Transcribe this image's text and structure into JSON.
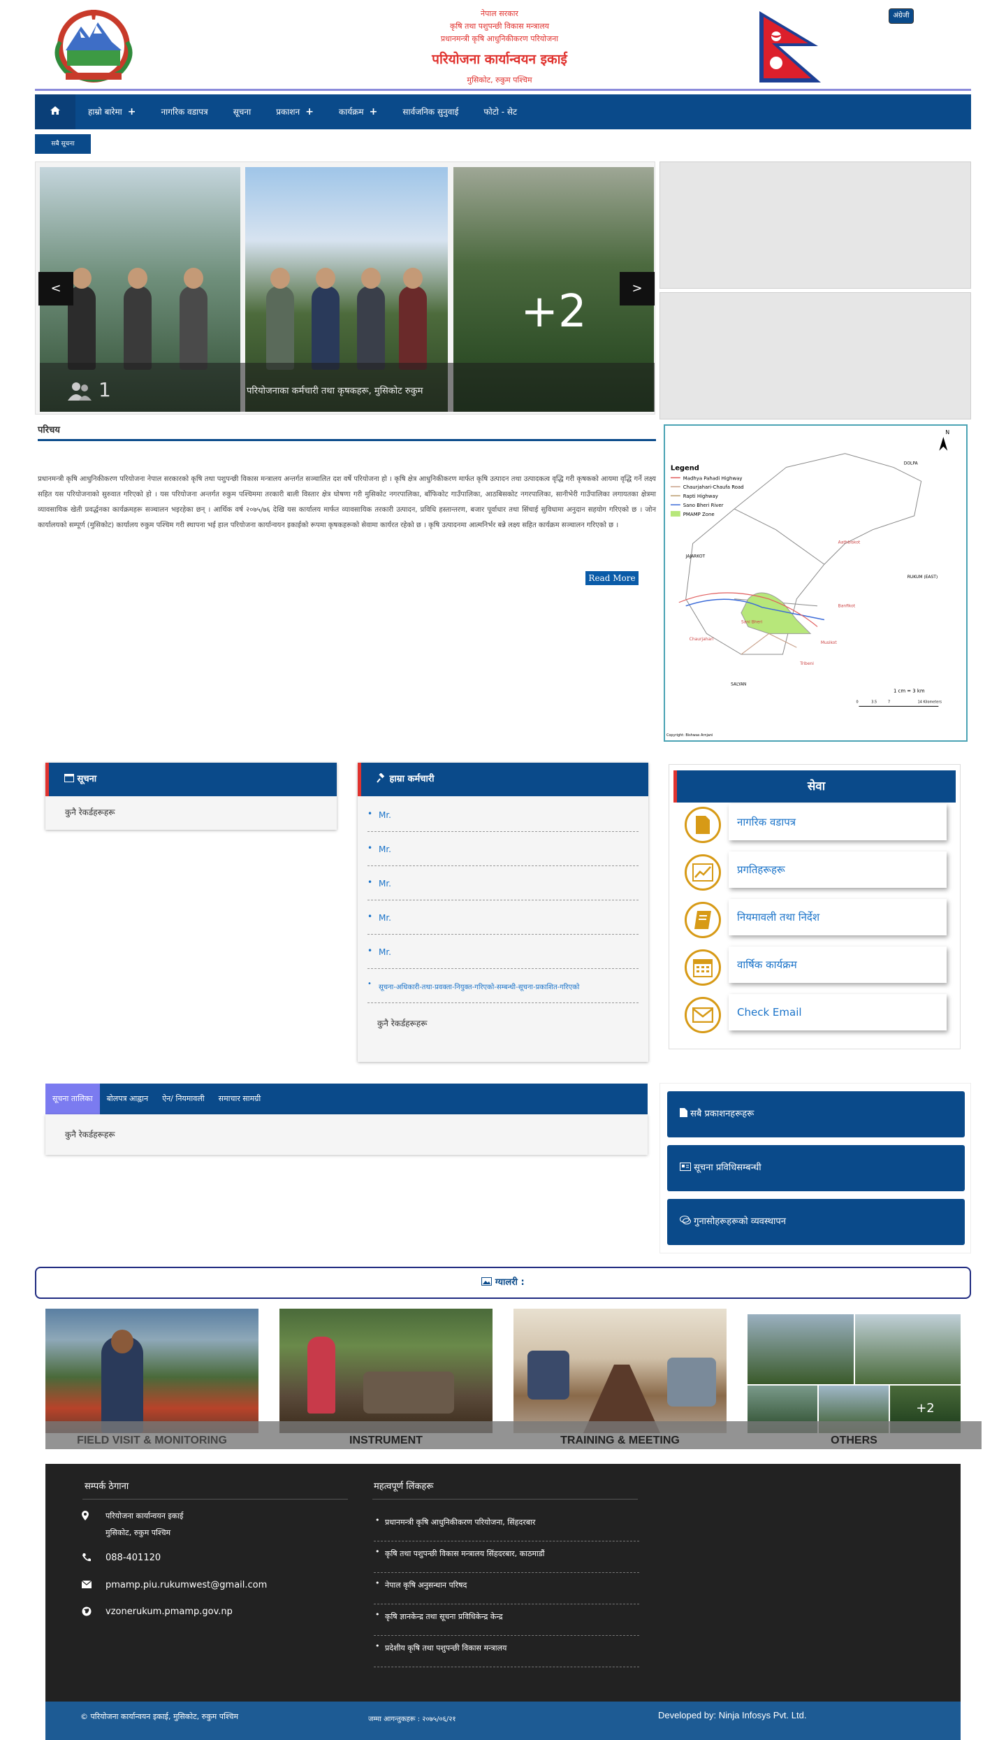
{
  "header": {
    "line1": "नेपाल सरकार",
    "line2": "कृषि तथा पशुपन्छी विकास मन्त्रालय",
    "line3": "प्रधानमन्त्री कृषि आधुनिकीकरण परियोजना",
    "title": "परियोजना कार्यान्वयन इकाई",
    "address": "मुसिकोट, रुकुम पश्चिम",
    "lang_button": "अंग्रेजी"
  },
  "nav": {
    "items": [
      {
        "label": "हाम्रो बारेमा",
        "plus": "+"
      },
      {
        "label": "नागरिक वडापत्र",
        "plus": ""
      },
      {
        "label": "सूचना",
        "plus": ""
      },
      {
        "label": "प्रकाशन",
        "plus": "+"
      },
      {
        "label": "कार्यक्रम",
        "plus": "+"
      },
      {
        "label": "सार्वजनिक सुनुवाई",
        "plus": ""
      },
      {
        "label": "फोटो - सेट",
        "plus": ""
      }
    ]
  },
  "notice_button": "सबै सूचना",
  "slider": {
    "count": "1",
    "caption": "परियोजनाका कर्मचारी तथा कृषकहरू, मुसिकोट रुकुम",
    "more": "+2",
    "prev": "<",
    "next": ">"
  },
  "about": {
    "title": "परिचय",
    "text": "प्रधानमन्त्री कृषि आधुनिकीकरण परियोजना नेपाल सरकारको कृषि तथा पशुपन्छी विकास मन्त्रालय अन्तर्गत सञ्चालित दश वर्षे परियोजना हो । कृषि क्षेत्र आधुनिकीकरण मार्फत कृषि उत्पादन तथा उत्पादकत्व वृद्धि गरी कृषकको आयमा वृद्धि गर्ने लक्ष्य सहित यस परियोजनाको सुरुवात गरिएको हो । यस परियोजना अन्तर्गत रुकुम पश्चिममा तरकारी बाली विस्तार क्षेत्र घोषणा गरी मुसिकोट नगरपालिका, बाँफिकोट गाउँपालिका, आठबिसकोट नगरपालिका, सानीभेरी गाउँपालिका लगायतका क्षेत्रमा व्यावसायिक खेती प्रवर्द्धनका कार्यक्रमहरू सञ्चालन भइरहेका छन् । आर्थिक वर्ष २०७५/७६ देखि यस कार्यालय मार्फत व्यावसायिक तरकारी उत्पादन, प्रविधि हस्तान्तरण, बजार पूर्वाधार तथा सिंचाई सुविधामा अनुदान सहयोग गरिएको छ । जोन कार्यालयको सम्पूर्ण (मुसिकोट) कार्यालय रुकुम पश्चिम गरी स्थापना भई हाल परियोजना कार्यान्वयन इकाईको रूपमा कृषकहरूको सेवामा कार्यरत रहेको छ । कृषि उत्पादनमा आत्मनिर्भर बन्ने लक्ष्य सहित कार्यक्रम सञ्चालन गरिएको छ ।",
    "read_more": "Read More"
  },
  "map": {
    "legend_title": "Legend",
    "legend": [
      {
        "label": "Madhya Pahadi Highway",
        "color": "#e05d5d"
      },
      {
        "label": "Chaurjahari-Chaufa Road",
        "color": "#c9a18a"
      },
      {
        "label": "Rapti Highway",
        "color": "#b99a6b"
      },
      {
        "label": "Sano Bheri River",
        "color": "#3a6ad8"
      },
      {
        "label": "PMAMP Zone",
        "color": "#b7e77a"
      }
    ],
    "labels": [
      "DOLPA",
      "JAJARKOT",
      "RUKUM (EAST)",
      "SALYAN",
      "Aathbiskot",
      "Banfikot",
      "Musikot",
      "Sani Bheri",
      "Tribeni",
      "Chaurjahari"
    ],
    "scale_text": "1 cm = 3 km",
    "scale_ticks": [
      "0",
      "3.5",
      "7",
      "14 Kilometers"
    ],
    "credit": "Copyright: Bishwas Arnjani",
    "north": "N"
  },
  "notices_panel": {
    "title": "सूचना",
    "empty": "कुनै रेकर्डहरूहरू"
  },
  "staff_panel": {
    "title": "हाम्रा कर्मचारी",
    "items": [
      "Mr.",
      "Mr.",
      "Mr.",
      "Mr.",
      "Mr.",
      "सूचना-अधिकारी-तथा-प्रवक्ता-नियुक्त-गरिएको-सम्बन्धी-सूचना-प्रकाशित-गरिएको"
    ],
    "empty": "कुनै रेकर्डहरूहरू"
  },
  "services": {
    "title": "सेवा",
    "items": [
      {
        "label": "नागरिक वडापत्र",
        "icon": "document-icon"
      },
      {
        "label": "प्रगतिहरूहरू",
        "icon": "chart-icon"
      },
      {
        "label": "नियमावली तथा निर्देश",
        "icon": "book-icon"
      },
      {
        "label": "वार्षिक कार्यक्रम",
        "icon": "calendar-icon"
      },
      {
        "label": "Check Email",
        "icon": "envelope-icon"
      }
    ]
  },
  "tabs": {
    "items": [
      "सूचना तालिका",
      "बोलपत्र आह्वान",
      "ऐन/ नियमावली",
      "समाचार सामग्री"
    ],
    "active": 0,
    "empty": "कुनै रेकर्डहरूहरू"
  },
  "right_buttons": [
    {
      "label": "सबै प्रकाशनहरूहरू",
      "icon": "file-icon"
    },
    {
      "label": "सूचना प्रविधिसम्बन्धी",
      "icon": "newspaper-icon"
    },
    {
      "label": "गुनासोहरूहरूको व्यवस्थापन",
      "icon": "comments-icon"
    }
  ],
  "gallery": {
    "title": "ग्यालरी :",
    "items": [
      {
        "label": "FIELD VISIT & MONITORING"
      },
      {
        "label": "INSTRUMENT"
      },
      {
        "label": "TRAINING & MEETING"
      },
      {
        "label": "OTHERS",
        "more": "+2"
      }
    ]
  },
  "footer": {
    "contact_title": "सम्पर्क ठेगाना",
    "office": "परियोजना कार्यान्वयन इकाई",
    "address": "मुसिकोट, रुकुम पश्चिम",
    "phone": "088-401120",
    "email": "pmamp.piu.rukumwest@gmail.com",
    "website": "vzonerukum.pmamp.gov.np",
    "links_title": "महत्वपूर्ण लिंकहरू",
    "links": [
      "प्रधानमन्त्री कृषि आधुनिकीकरण परियोजना, सिंहदरबार",
      "कृषि तथा पशुपन्छी विकास मन्त्रालय सिंहदरबार, काठमाडौं",
      "नेपाल कृषि अनुसन्धान परिषद",
      "कृषि ज्ञानकेन्द्र तथा सूचना प्रविधिकेन्द्र केन्द्र",
      "प्रदेशीय कृषि तथा पशुपन्छी विकास मन्त्रालय"
    ],
    "copyright": "© परियोजना कार्यान्वयन इकाई, मुसिकोट, रुकुम पश्चिम",
    "visitors": "जम्मा आगन्तुकहरू : २०७५/०६/२१",
    "developer": "Developed by: Ninja Infosys Pvt. Ltd."
  }
}
